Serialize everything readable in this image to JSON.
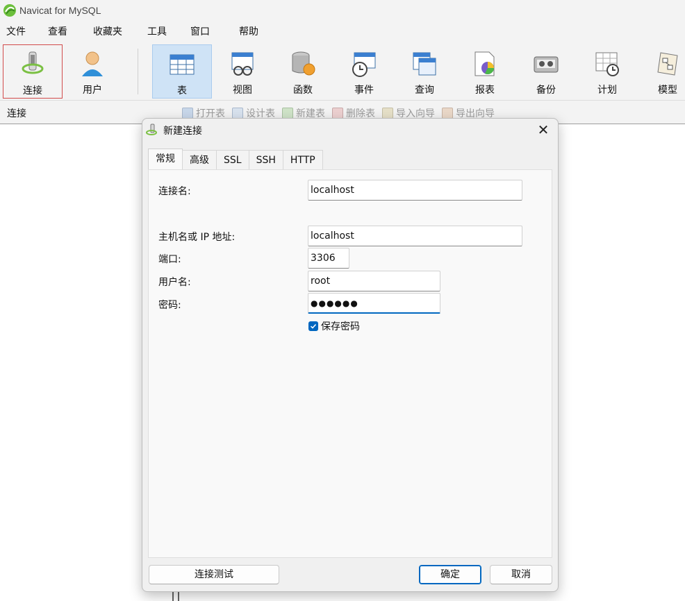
{
  "window": {
    "title": "Navicat for MySQL"
  },
  "menu": [
    "文件",
    "查看",
    "收藏夹",
    "工具",
    "窗口",
    "帮助"
  ],
  "toolbar": {
    "connect": "连接",
    "user": "用户",
    "table": "表",
    "view": "视图",
    "function": "函数",
    "event": "事件",
    "query": "查询",
    "report": "报表",
    "backup": "备份",
    "schedule": "计划",
    "model": "模型"
  },
  "objbar": {
    "title": "连接",
    "actions": [
      "打开表",
      "设计表",
      "新建表",
      "删除表",
      "导入向导",
      "导出向导"
    ]
  },
  "dialog": {
    "title": "新建连接",
    "tabs": [
      "常规",
      "高级",
      "SSL",
      "SSH",
      "HTTP"
    ],
    "labels": {
      "connection_name": "连接名:",
      "host": "主机名或 IP 地址:",
      "port": "端口:",
      "username": "用户名:",
      "password": "密码:"
    },
    "values": {
      "connection_name": "localhost",
      "host": "localhost",
      "port": "3306",
      "username": "root",
      "password": "●●●●●●"
    },
    "save_password": {
      "label": "保存密码",
      "checked": true
    },
    "buttons": {
      "test": "连接测试",
      "ok": "确定",
      "cancel": "取消"
    }
  },
  "colors": {
    "accent": "#0067c0",
    "selected_tool": "#cfe3f6",
    "highlight_border": "#d14a4a"
  }
}
